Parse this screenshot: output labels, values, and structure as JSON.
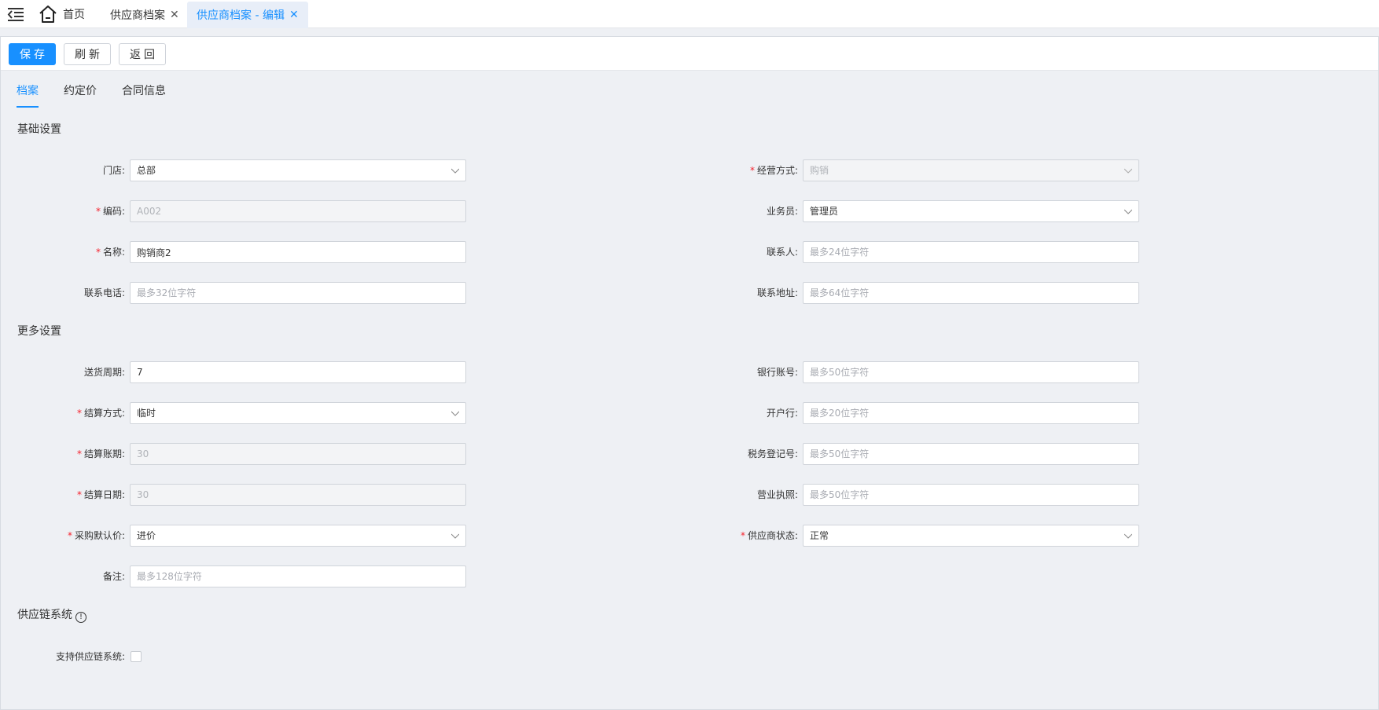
{
  "topbar": {
    "home_label": "首页",
    "tabs": [
      {
        "label": "供应商档案"
      },
      {
        "label": "供应商档案 - 编辑"
      }
    ]
  },
  "toolbar": {
    "save": "保存",
    "refresh": "刷新",
    "back": "返回"
  },
  "subtabs": [
    "档案",
    "约定价",
    "合同信息"
  ],
  "sections": {
    "basic": "基础设置",
    "more": "更多设置",
    "supply_chain": "供应链系统"
  },
  "fields": {
    "store": {
      "label": "门店:",
      "value": "总部"
    },
    "business_mode": {
      "label": "经营方式:",
      "value": "购销"
    },
    "code": {
      "label": "编码:",
      "value": "A002"
    },
    "salesman": {
      "label": "业务员:",
      "value": "管理员"
    },
    "name": {
      "label": "名称:",
      "value": "购销商2"
    },
    "contact": {
      "label": "联系人:",
      "placeholder": "最多24位字符"
    },
    "phone": {
      "label": "联系电话:",
      "placeholder": "最多32位字符"
    },
    "address": {
      "label": "联系地址:",
      "placeholder": "最多64位字符"
    },
    "delivery_cycle": {
      "label": "送货周期:",
      "value": "7"
    },
    "bank_account": {
      "label": "银行账号:",
      "placeholder": "最多50位字符"
    },
    "settle_method": {
      "label": "结算方式:",
      "value": "临时"
    },
    "bank_name": {
      "label": "开户行:",
      "placeholder": "最多20位字符"
    },
    "settle_period": {
      "label": "结算账期:",
      "value": "30"
    },
    "tax_no": {
      "label": "税务登记号:",
      "placeholder": "最多50位字符"
    },
    "settle_date": {
      "label": "结算日期:",
      "value": "30"
    },
    "license": {
      "label": "营业执照:",
      "placeholder": "最多50位字符"
    },
    "purchase_price": {
      "label": "采购默认价:",
      "value": "进价"
    },
    "supplier_status": {
      "label": "供应商状态:",
      "value": "正常"
    },
    "remark": {
      "label": "备注:",
      "placeholder": "最多128位字符"
    },
    "support_supply_chain": {
      "label": "支持供应链系统:",
      "checked": false
    }
  },
  "required_mark": "*",
  "colors": {
    "accent": "#1890ff",
    "required": "#f5222d",
    "background": "#eef0f4"
  }
}
